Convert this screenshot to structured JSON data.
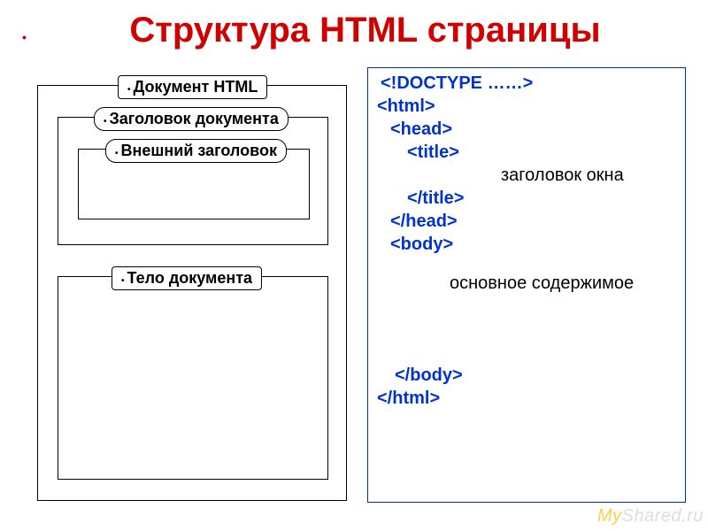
{
  "title": "Структура HTML страницы",
  "diagram": {
    "docHtml": "Документ HTML",
    "head": "Заголовок документа",
    "title": "Внешний заголовок",
    "body": "Тело документа"
  },
  "code": {
    "doctype": "<!DOCTYPE ……>",
    "html_open": "<html>",
    "head_open": "<head>",
    "title_open": "<title>",
    "title_text": "заголовок окна",
    "title_close": "</title>",
    "head_close": "</head>",
    "body_open": "<body>",
    "body_text": "основное содержимое",
    "body_close": "</body>",
    "html_close": "</html>"
  },
  "watermark_prefix": "My",
  "watermark_suffix": "Shared.ru"
}
